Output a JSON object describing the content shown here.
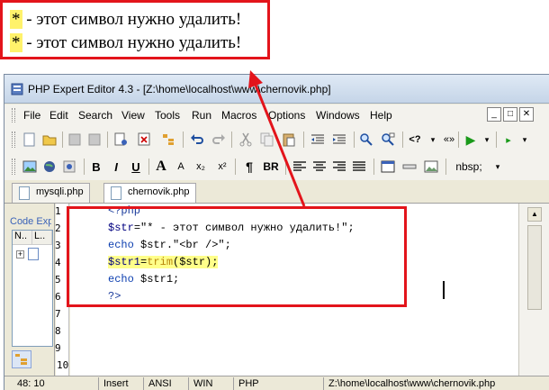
{
  "output": {
    "line1_star": "*",
    "line1_text": " - этот символ нужно удалить!",
    "line2_star": "*",
    "line2_text": " - этот символ нужно удалить!"
  },
  "window": {
    "title": "PHP Expert Editor 4.3 - [Z:\\home\\localhost\\www\\chernovik.php]"
  },
  "menu": {
    "items": [
      "File",
      "Edit",
      "Search",
      "View",
      "Tools",
      "Run",
      "Macros",
      "Options",
      "Windows",
      "Help"
    ]
  },
  "toolbar2": {
    "bold": "B",
    "italic": "I",
    "underline": "U",
    "font_up": "A",
    "subscript": "x₂",
    "superscript": "x²",
    "paragraph": "¶",
    "br": "BR",
    "nbsp": "nbsp;"
  },
  "tabs": [
    {
      "label": "mysqli.php"
    },
    {
      "label": "chernovik.php"
    }
  ],
  "left_panel": {
    "title": "Code Exp",
    "col1": "N..",
    "col2": "L.."
  },
  "line_numbers": [
    "1",
    "2",
    "3",
    "4",
    "5",
    "6",
    "7",
    "8",
    "9",
    "10"
  ],
  "code": {
    "l1": "<?php",
    "l2_var": "$str",
    "l2_rest": "=\"* - этот символ нужно удалить!\";",
    "l3_echo": "echo",
    "l3_rest": " $str.\"<br />\";",
    "l4_var": "$str1",
    "l4_eq": "=",
    "l4_fn": "trim",
    "l4_rest": "($str);",
    "l5_echo": "echo",
    "l5_rest": " $str1;",
    "l6": "?>"
  },
  "status": {
    "position": "48: 10",
    "mode": "Insert",
    "encoding": "ANSI",
    "line_endings": "WIN",
    "syntax": "PHP",
    "path": "Z:\\home\\localhost\\www\\chernovik.php"
  },
  "colors": {
    "annotation_red": "#e3141b",
    "highlight_yellow": "#ffff8a"
  }
}
